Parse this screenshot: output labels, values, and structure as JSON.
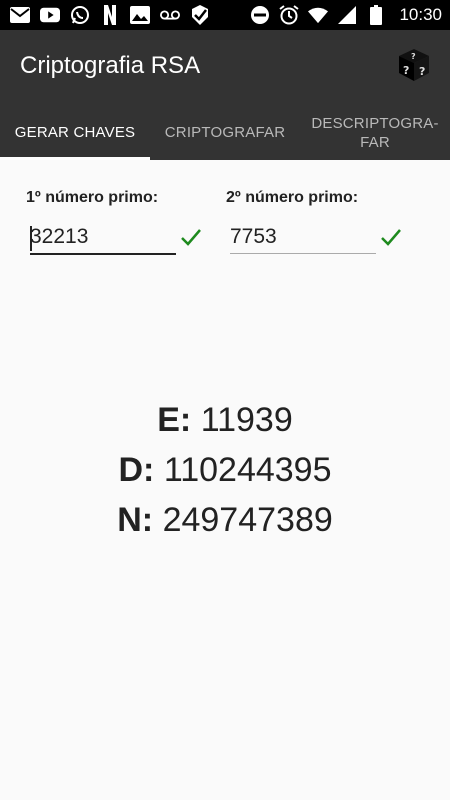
{
  "status_bar": {
    "time": "10:30",
    "left_icons": [
      "mail-icon",
      "youtube-icon",
      "whatsapp-icon",
      "netflix-icon",
      "image-icon",
      "voicemail-icon",
      "check-badge-icon"
    ],
    "right_icons": [
      "do-not-disturb-icon",
      "alarm-icon",
      "wifi-icon",
      "signal-icon",
      "battery-icon"
    ]
  },
  "app_bar": {
    "title": "Criptografia RSA",
    "action_icon": "dice-icon"
  },
  "tabs": [
    {
      "label": "GERAR CHAVES",
      "active": true
    },
    {
      "label": "CRIPTOGRAFAR",
      "active": false
    },
    {
      "label": "DESCRIPTOGRA-\nFAR",
      "active": false
    }
  ],
  "form": {
    "prime1": {
      "label": "1º número primo:",
      "value": "32213",
      "valid": true
    },
    "prime2": {
      "label": "2º número primo:",
      "value": "7753",
      "valid": true
    }
  },
  "results": {
    "e_label": "E:",
    "e_value": "11939",
    "d_label": "D:",
    "d_value": "110244395",
    "n_label": "N:",
    "n_value": "249747389"
  },
  "colors": {
    "app_bar": "#333333",
    "status_bar": "#000000",
    "check": "#1e8a1e",
    "background": "#fafafa"
  }
}
